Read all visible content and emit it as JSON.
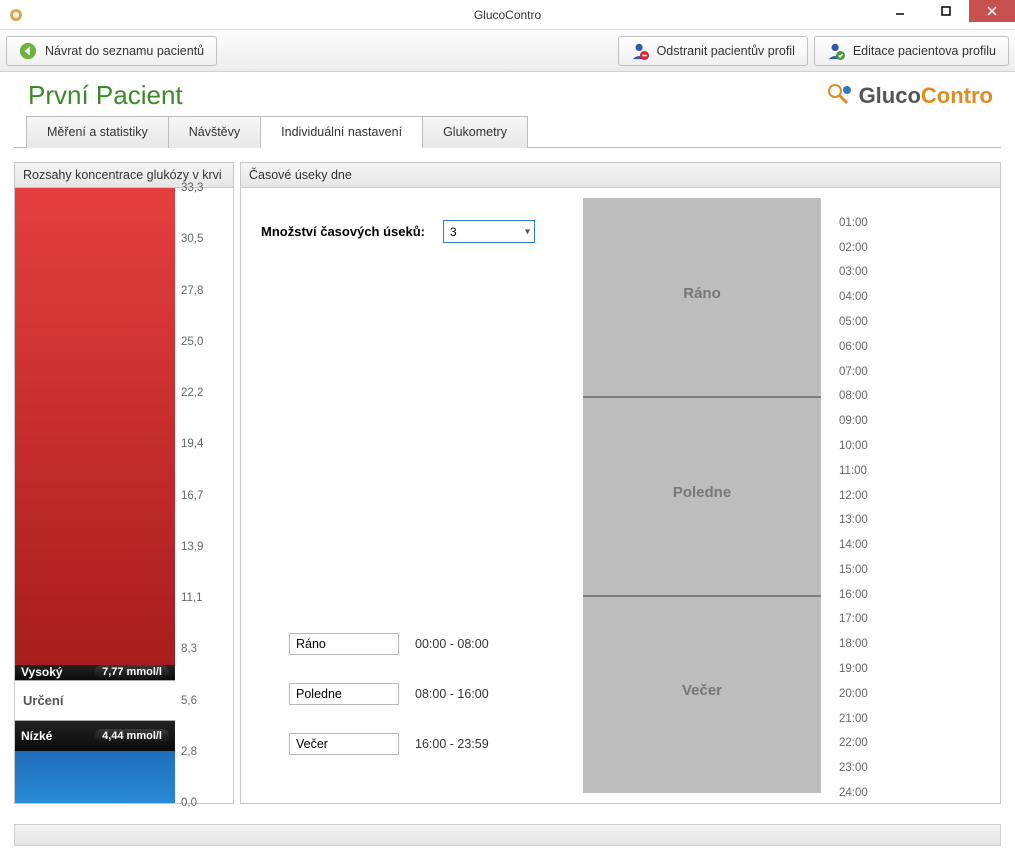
{
  "window": {
    "title": "GlucoContro"
  },
  "toolbar": {
    "back_label": "Návrat do seznamu pacientů",
    "remove_label": "Odstranit pacientův profil",
    "edit_label": "Editace pacientova profilu"
  },
  "header": {
    "patient_name": "První Pacient",
    "brand_g": "Gluco",
    "brand_c": "Contro"
  },
  "tabs": [
    {
      "label": "Měření a statistiky",
      "active": false
    },
    {
      "label": "Návštěvy",
      "active": false
    },
    {
      "label": "Individuální nastavení",
      "active": true
    },
    {
      "label": "Glukometry",
      "active": false
    }
  ],
  "left_panel": {
    "title": "Rozsahy koncentrace glukózy v krvi",
    "scale": [
      "33,3",
      "30,5",
      "27,8",
      "25,0",
      "22,2",
      "19,4",
      "16,7",
      "13,9",
      "11,1",
      "8,3",
      "5,6",
      "2,8",
      "0,0"
    ],
    "high_label": "Vysoký",
    "high_value": "7,77  mmol/l",
    "mid_label": "Určení",
    "low_label": "Nízké",
    "low_value": "4,44  mmol/l"
  },
  "right_panel": {
    "title": "Časové úseky dne",
    "count_label": "Množství časových úseků:",
    "count_value": "3",
    "periods": [
      {
        "name": "Ráno",
        "range": "00:00 - 08:00"
      },
      {
        "name": "Poledne",
        "range": "08:00 - 16:00"
      },
      {
        "name": "Večer",
        "range": "16:00 - 23:59"
      }
    ],
    "timeline": {
      "hours": [
        "01:00",
        "02:00",
        "03:00",
        "04:00",
        "05:00",
        "06:00",
        "07:00",
        "08:00",
        "09:00",
        "10:00",
        "11:00",
        "12:00",
        "13:00",
        "14:00",
        "15:00",
        "16:00",
        "17:00",
        "18:00",
        "19:00",
        "20:00",
        "21:00",
        "22:00",
        "23:00",
        "24:00"
      ],
      "segments": [
        {
          "label": "Ráno",
          "start_pct": 0,
          "end_pct": 33.33
        },
        {
          "label": "Poledne",
          "start_pct": 33.33,
          "end_pct": 66.67
        },
        {
          "label": "Večer",
          "start_pct": 66.67,
          "end_pct": 100
        }
      ]
    }
  },
  "chart_data": {
    "type": "bar",
    "title": "Rozsahy koncentrace glukózy v krvi",
    "ylabel": "mmol/l",
    "ylim": [
      0,
      33.3
    ],
    "thresholds": {
      "high": 7.77,
      "low": 4.44
    },
    "segments": [
      {
        "name": "Vysoký",
        "from": 7.77,
        "to": 33.3,
        "color": "#d02b2b"
      },
      {
        "name": "Určení",
        "from": 4.44,
        "to": 7.77,
        "color": "#ffffff"
      },
      {
        "name": "Nízké",
        "from": 0,
        "to": 4.44,
        "color": "#2a8ad8"
      }
    ],
    "ticks": [
      33.3,
      30.5,
      27.8,
      25.0,
      22.2,
      19.4,
      16.7,
      13.9,
      11.1,
      8.3,
      5.6,
      2.8,
      0.0
    ]
  }
}
